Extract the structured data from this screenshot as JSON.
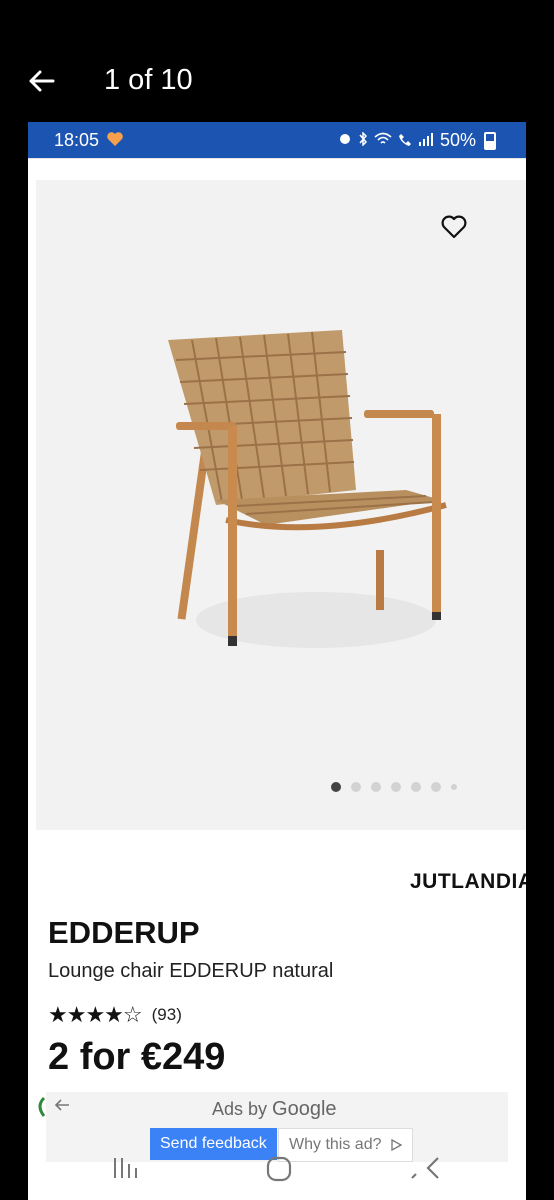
{
  "viewer": {
    "counter": "1 of 10"
  },
  "status_bar": {
    "time": "18:05",
    "battery": "50%",
    "bg_color": "#1c54b2"
  },
  "gallery": {
    "image_alt": "Lounge chair EDDERUP natural",
    "total_dots": 7,
    "active_dot": 1
  },
  "product": {
    "brand": "JUTLANDIA",
    "name": "EDDERUP",
    "description": "Lounge chair EDDERUP natural",
    "rating_stars": "★★★★☆",
    "rating_value": 4,
    "review_count": "(93)",
    "price": "2 for €249"
  },
  "ad": {
    "ads_by": "Ads by",
    "google": "Google",
    "send_feedback": "Send feedback",
    "why_this_ad": "Why this ad?"
  },
  "icons": {
    "back": "arrow-left-icon",
    "heart": "heart-outline-icon",
    "recent": "recents-icon",
    "home": "home-icon",
    "back_nav": "back-nav-icon"
  }
}
